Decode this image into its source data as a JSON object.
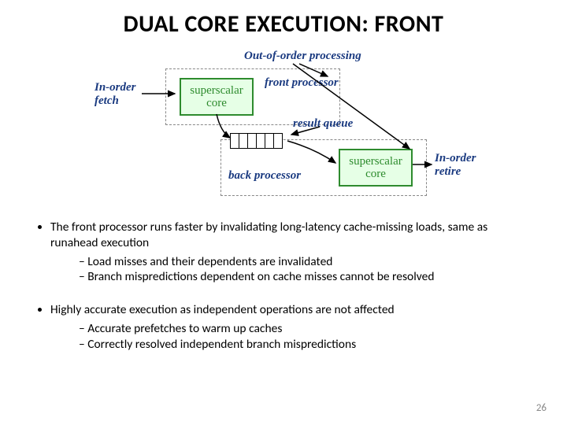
{
  "title": "DUAL CORE EXECUTION: FRONT",
  "diagram": {
    "inorder_fetch": "In-order\nfetch",
    "ooo_processing": "Out-of-order  processing",
    "front_processor": "front processor",
    "back_processor": "back processor",
    "result_queue": "result queue",
    "inorder_retire": "In-order\nretire",
    "core_label": "superscalar\ncore"
  },
  "bullets": {
    "b1": "The front processor runs faster by invalidating long-latency cache-missing loads, same as runahead execution",
    "b1_sub": [
      "Load misses and their dependents are invalidated",
      "Branch mispredictions dependent on cache misses cannot be resolved"
    ],
    "b2": "Highly accurate execution as independent operations are not affected",
    "b2_sub": [
      "Accurate prefetches to warm up caches",
      "Correctly resolved independent branch mispredictions"
    ]
  },
  "page_number": "26"
}
